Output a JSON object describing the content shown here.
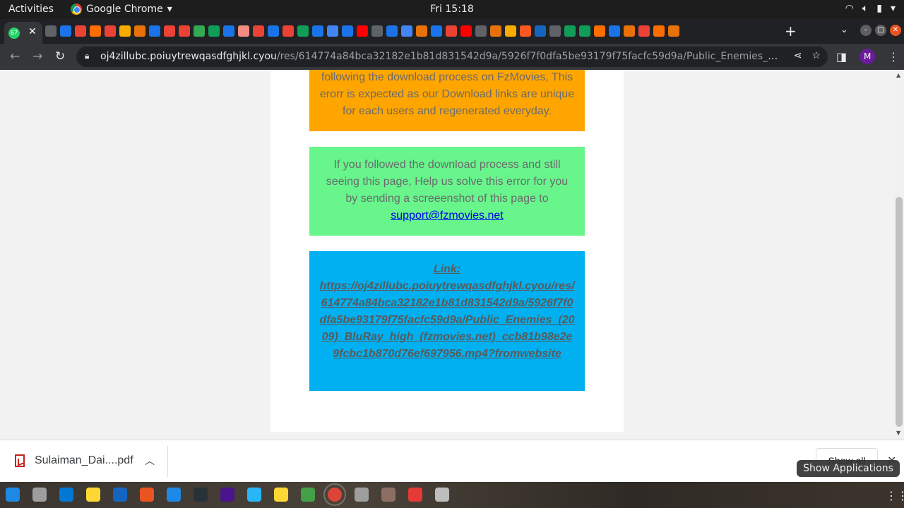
{
  "topbar": {
    "activities": "Activities",
    "app_name": "Google Chrome",
    "clock": "Fri 15:18"
  },
  "tabs": {
    "active_badge": "67",
    "favicon_colors": [
      "#5f6368",
      "#1a73e8",
      "#ea4335",
      "#ff6d00",
      "#ea4335",
      "#f9ab00",
      "#e8710a",
      "#1a73e8",
      "#ea4335",
      "#ea4335",
      "#34a853",
      "#0f9d58",
      "#1a73e8",
      "#f28b82",
      "#ea4335",
      "#1a73e8",
      "#ea4335",
      "#0f9d58",
      "#1a73e8",
      "#4285f4",
      "#1a73e8",
      "#ff0000",
      "#5f6368",
      "#1a73e8",
      "#4285f4",
      "#e8710a",
      "#1a73e8",
      "#ea4335",
      "#ff0000",
      "#5f6368",
      "#e8710a",
      "#f9ab00",
      "#ff5722",
      "#1565c0",
      "#5f6368",
      "#0f9d58",
      "#0f9d58",
      "#ff6d00",
      "#1a73e8",
      "#e8710a",
      "#ea4335",
      "#ff6d00",
      "#e8710a"
    ]
  },
  "toolbar": {
    "url_host": "oj4zillubc.poiuytrewqasdfghjkl.cyou",
    "url_path": "/res/614774a84bca32182e1b81d831542d9a/5926f7f0dfa5be93179f75facfc59d9a/Public_Enemies_(2009)_BluRa...",
    "profile_initial": "M"
  },
  "page": {
    "orange_notice": "following the download process on FzMovies, This erorr is expected as our Download links are unique for each users and regenerated everyday.",
    "green_notice": "If you followed the download process and still seeing this page, Help us solve this error for you by sending a screeenshot of this page to",
    "support_email": "support@fzmovies.net",
    "link_label": "Link:",
    "link_url": "https://oj4zillubc.poiuytrewqasdfghjkl.cyou/res/614774a84bca32182e1b81d831542d9a/5926f7f0dfa5be93179f75facfc59d9a/Public_Enemies_(2009)_BluRay_high_(fzmovies.net)_ccb81b98e2e9fcbc1b870d76ef697956.mp4?fromwebsite",
    "colors": {
      "orange": "#ffa500",
      "green": "#67f58c",
      "blue": "#00b0f0"
    }
  },
  "downloads": {
    "filename": "Sulaiman_Dai....pdf",
    "show_all": "Show all"
  },
  "tooltip": "Show Applications",
  "dock": {
    "icon_colors": [
      "#1e88e5",
      "#9e9e9e",
      "#0078d4",
      "#fdd835",
      "#1565c0",
      "#e95420",
      "#1e88e5",
      "#263238",
      "#4a148c",
      "#29b6f6",
      "#fdd835",
      "#43a047",
      "#db4437",
      "#9e9e9e",
      "#8d6e63",
      "#e53935",
      "#bdbdbd"
    ]
  }
}
